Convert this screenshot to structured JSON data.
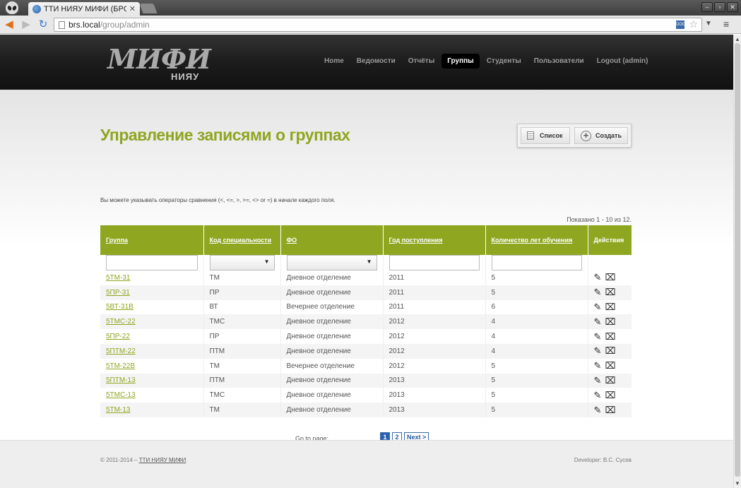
{
  "browser": {
    "tab_title": "ТТИ НИЯУ МИФИ (БРС",
    "url_host": "brs.local",
    "url_path": "/group/admin"
  },
  "site": {
    "logo_main": "МИФИ",
    "logo_sub": "НИЯУ",
    "nav": [
      {
        "label": "Home"
      },
      {
        "label": "Ведомости"
      },
      {
        "label": "Отчёты"
      },
      {
        "label": "Группы"
      },
      {
        "label": "Студенты"
      },
      {
        "label": "Пользователи"
      },
      {
        "label": "Logout (admin)"
      }
    ]
  },
  "page": {
    "title": "Управление записями о группах",
    "hint": "Вы можете указывать операторы сравнения (<, <=, >, >=, <> or =) в начале каждого поля.",
    "summary": "Показано 1 - 10 из 12.",
    "actions": {
      "list": "Список",
      "create": "Создать"
    }
  },
  "table": {
    "headers": {
      "group": "Группа",
      "spec": "Код специальности",
      "form": "ФО",
      "year": "Год поступления",
      "duration": "Количество лет обучения",
      "actions": "Действия"
    },
    "rows": [
      {
        "group": "5ТМ-31",
        "spec": "ТМ",
        "form": "Дневное отделение",
        "year": "2011",
        "duration": "5"
      },
      {
        "group": "5ПР-31",
        "spec": "ПР",
        "form": "Дневное отделение",
        "year": "2011",
        "duration": "5"
      },
      {
        "group": "5ВТ-31В",
        "spec": "ВТ",
        "form": "Вечернее отделение",
        "year": "2011",
        "duration": "6"
      },
      {
        "group": "5ТМС-22",
        "spec": "ТМС",
        "form": "Дневное отделение",
        "year": "2012",
        "duration": "4"
      },
      {
        "group": "5ПР-22",
        "spec": "ПР",
        "form": "Дневное отделение",
        "year": "2012",
        "duration": "4"
      },
      {
        "group": "5ПТМ-22",
        "spec": "ПТМ",
        "form": "Дневное отделение",
        "year": "2012",
        "duration": "4"
      },
      {
        "group": "5ТМ-22В",
        "spec": "ТМ",
        "form": "Вечернее отделение",
        "year": "2012",
        "duration": "5"
      },
      {
        "group": "5ПТМ-13",
        "spec": "ПТМ",
        "form": "Дневное отделение",
        "year": "2013",
        "duration": "5"
      },
      {
        "group": "5ТМС-13",
        "spec": "ТМС",
        "form": "Дневное отделение",
        "year": "2013",
        "duration": "5"
      },
      {
        "group": "5ТМ-13",
        "spec": "ТМ",
        "form": "Дневное отделение",
        "year": "2013",
        "duration": "5"
      }
    ]
  },
  "pager": {
    "label": "Go to page:",
    "pages": [
      "1",
      "2"
    ],
    "next": "Next >"
  },
  "footer": {
    "copyright": "© 2011-2014 –",
    "link": "ТТИ НИЯУ МИФИ",
    "developer": "Developer: В.С. Сусев"
  },
  "colors": {
    "accent": "#8ea620",
    "link_blue": "#2a62b0"
  }
}
